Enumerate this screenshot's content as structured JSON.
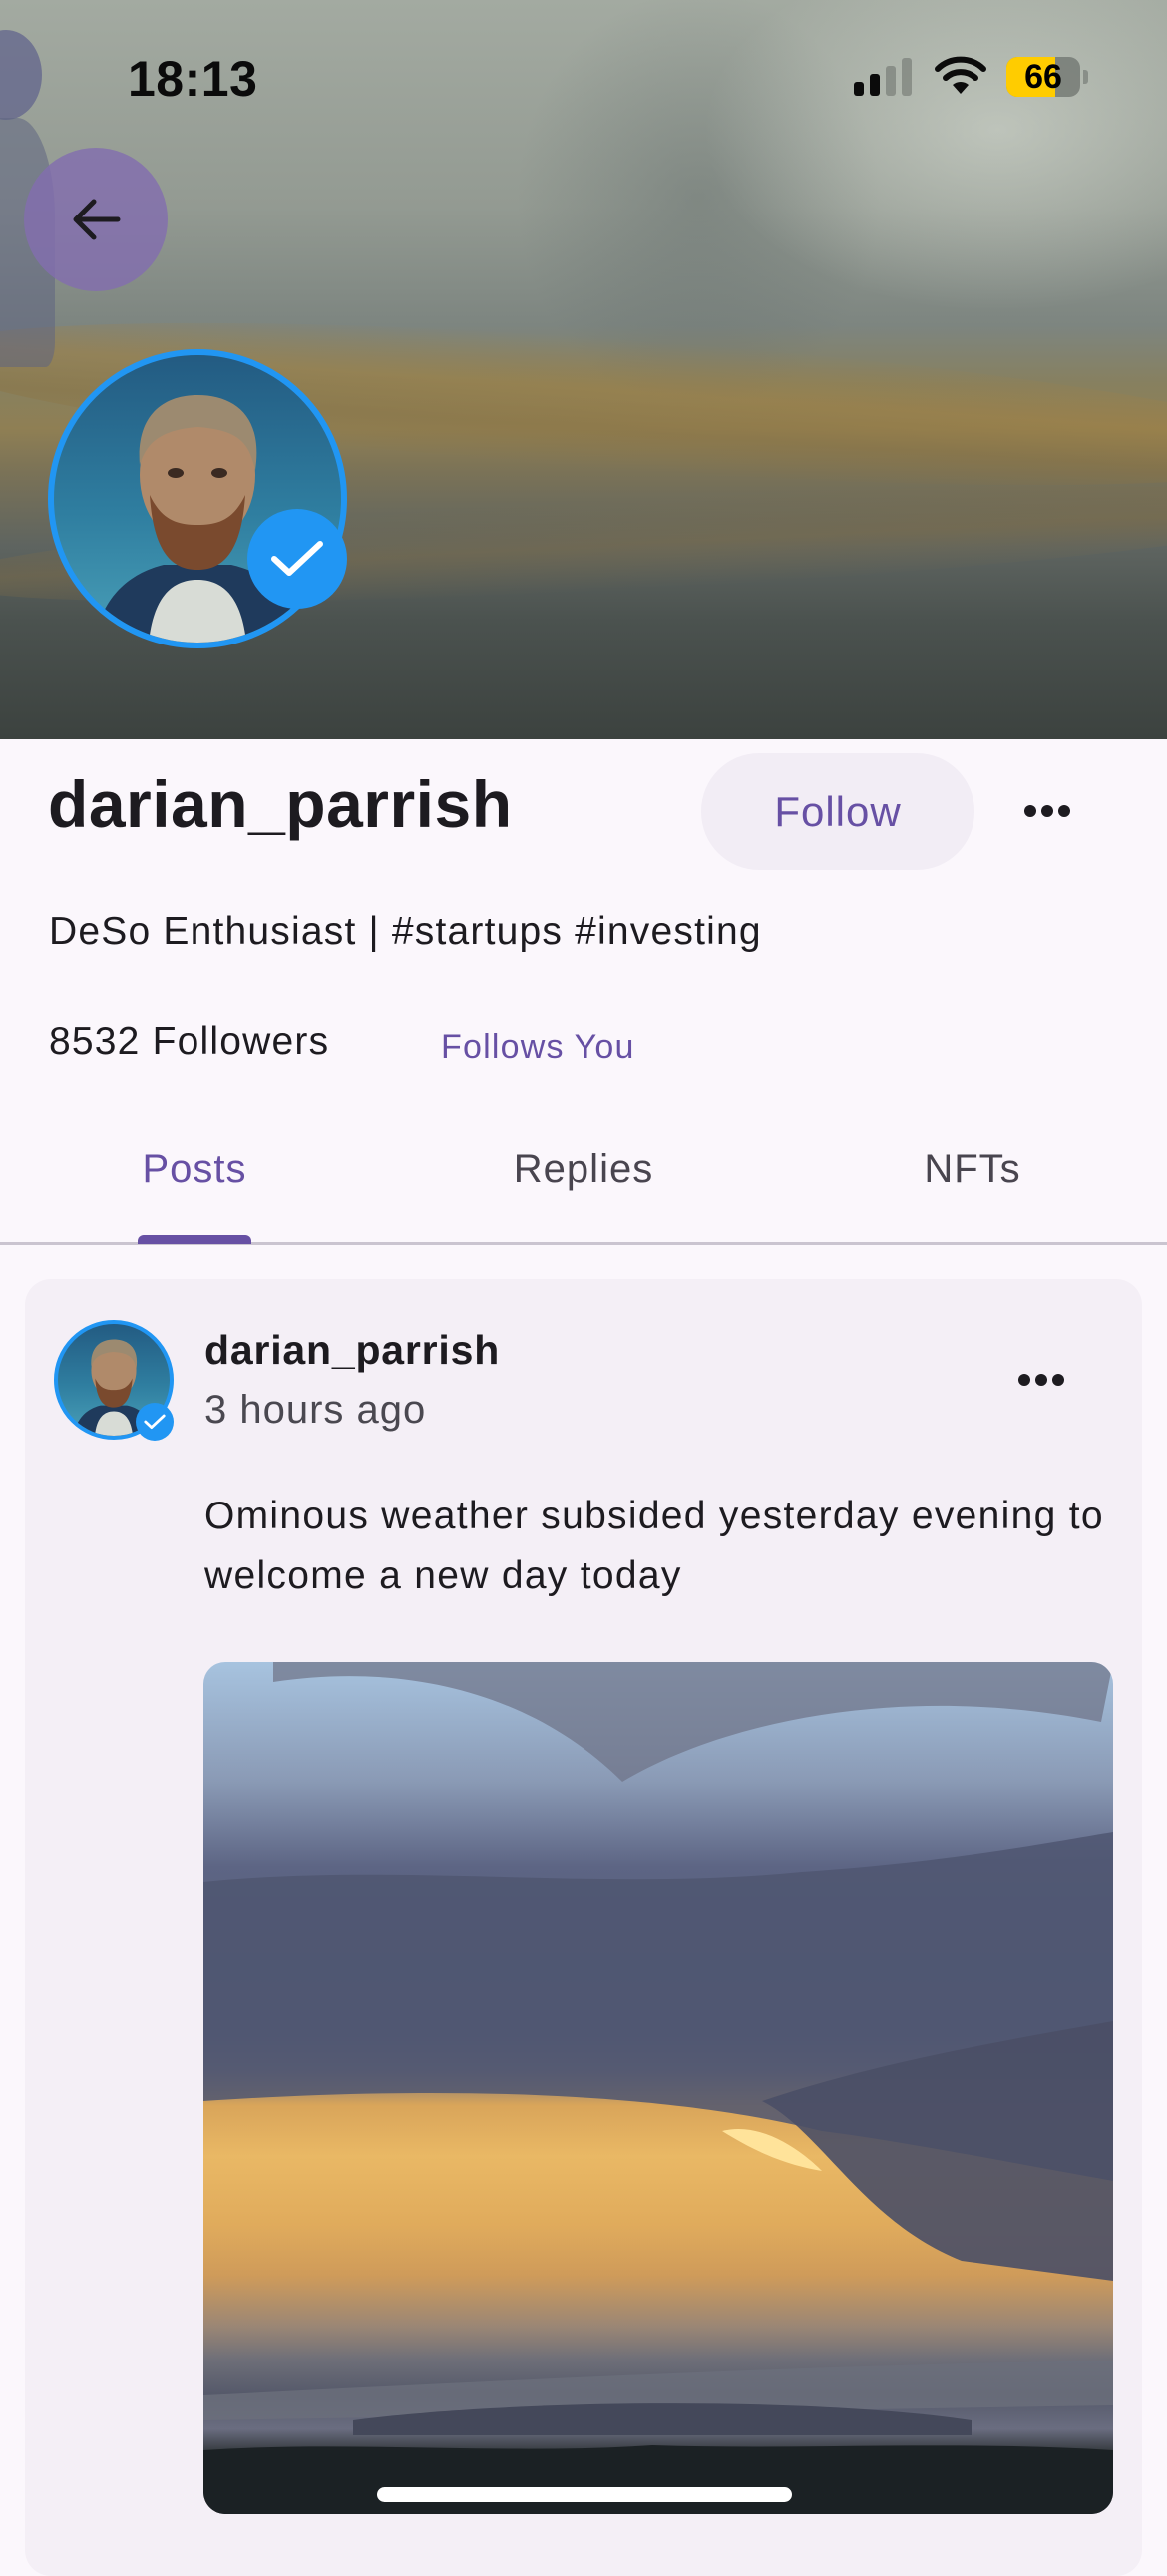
{
  "status_bar": {
    "time": "18:13",
    "signal_bars_active": 2,
    "signal_bars_total": 4,
    "wifi": "wifi-icon",
    "battery_percent": "66",
    "battery_level": 0.66,
    "battery_color": "#ffcc00"
  },
  "header": {
    "back_icon": "arrow-left-icon"
  },
  "profile": {
    "username": "darian_parrish",
    "verified": true,
    "bio": "DeSo Enthusiast | #startups #investing",
    "followers_count": "8532",
    "followers_text": "8532 Followers",
    "follows_you_label": "Follows You",
    "follow_button_label": "Follow",
    "more_icon": "more-horizontal-icon"
  },
  "tabs": [
    {
      "label": "Posts",
      "active": true
    },
    {
      "label": "Replies",
      "active": false
    },
    {
      "label": "NFTs",
      "active": false
    }
  ],
  "posts": [
    {
      "author": "darian_parrish",
      "verified": true,
      "timestamp": "3 hours ago",
      "body": "Ominous weather subsided yesterday evening to welcome a new day today",
      "image_description": "sunset over water with dark storm clouds and golden light rays",
      "more_icon": "more-horizontal-icon"
    }
  ],
  "colors": {
    "accent": "#6750a4",
    "verified_blue": "#2196f3",
    "background": "#fbf7fc",
    "card": "#f4eff6",
    "text": "#1d1b20"
  }
}
